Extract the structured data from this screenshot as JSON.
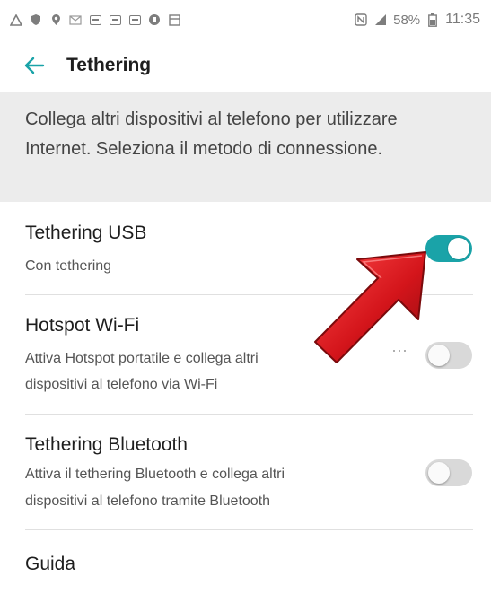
{
  "status_bar": {
    "battery": "58%",
    "time": "11:35",
    "left_icons": [
      "warning-icon",
      "shield-icon",
      "location-icon",
      "message-icon",
      "gallery-icon",
      "gallery-icon",
      "gallery-icon",
      "vpn-icon",
      "screenshot-icon"
    ],
    "right_icons": [
      "nfc-icon",
      "signal-icon",
      "battery-icon"
    ]
  },
  "app_bar": {
    "title": "Tethering",
    "back_icon": "back-arrow-icon",
    "accent": "#1aa3a8"
  },
  "info": {
    "text": "Collega altri dispositivi al telefono per utilizzare Internet. Seleziona il metodo di connessione."
  },
  "items": [
    {
      "title": "Tethering USB",
      "subtitle": "Con tethering",
      "toggle": "on"
    },
    {
      "title": "Hotspot Wi-Fi",
      "subtitle_line1": "Attiva Hotspot portatile e collega altri",
      "subtitle_line2": "dispositivi al telefono via Wi-Fi",
      "toggle": "off",
      "more": "⋯"
    },
    {
      "title": "Tethering Bluetooth",
      "subtitle_line1": "Attiva il tethering Bluetooth e collega altri",
      "subtitle_line2": "dispositivi al telefono tramite Bluetooth",
      "toggle": "off"
    },
    {
      "title": "Guida"
    }
  ],
  "overlay": {
    "arrow_color": "#d4151b"
  }
}
